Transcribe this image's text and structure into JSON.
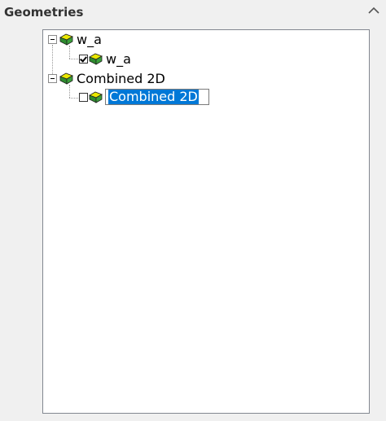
{
  "panel": {
    "title": "Geometries"
  },
  "tree": {
    "nodes": [
      {
        "label": "w_a",
        "expanded": true,
        "children": [
          {
            "label": "w_a",
            "checked": true
          }
        ]
      },
      {
        "label": "Combined 2D",
        "expanded": true,
        "children": [
          {
            "label": "Combined 2D",
            "checked": false,
            "editing": true
          }
        ]
      }
    ]
  },
  "colors": {
    "selection": "#0078d7",
    "icon_top": "#e8e800",
    "icon_side": "#2e8b2e"
  }
}
